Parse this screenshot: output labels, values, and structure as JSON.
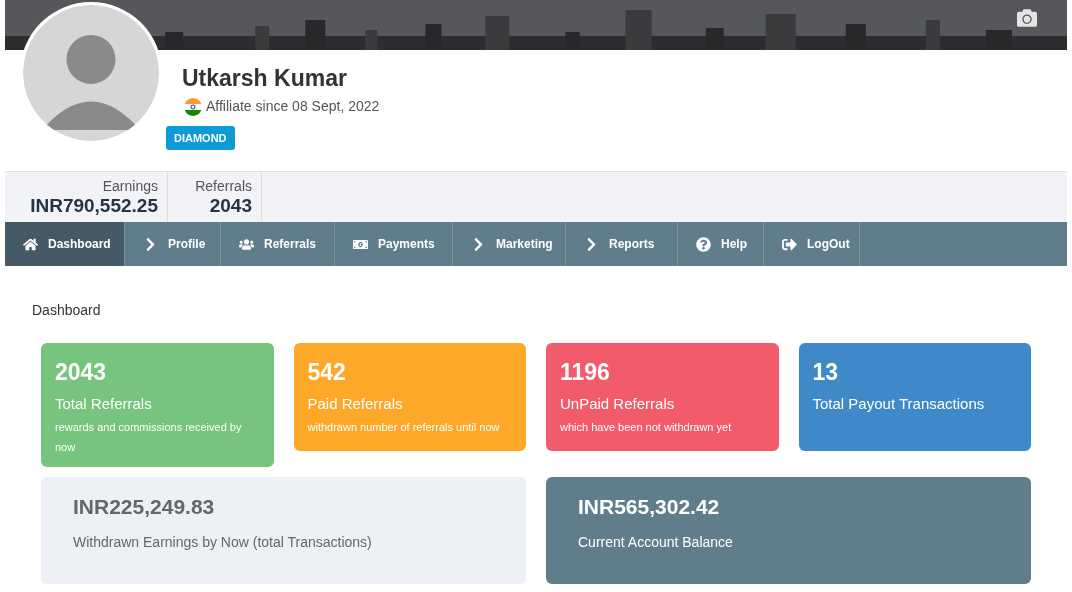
{
  "profile": {
    "name": "Utkarsh Kumar",
    "since": "Affiliate since 08 Sept, 2022",
    "badge": "DIAMOND"
  },
  "stats": [
    {
      "label": "Earnings",
      "value": "INR790,552.25"
    },
    {
      "label": "Referrals",
      "value": "2043"
    }
  ],
  "nav": [
    {
      "label": "Dashboard",
      "selected": true
    },
    {
      "label": "Profile",
      "selected": false
    },
    {
      "label": "Referrals",
      "selected": false
    },
    {
      "label": "Payments",
      "selected": false
    },
    {
      "label": "Marketing",
      "selected": false
    },
    {
      "label": "Reports",
      "selected": false
    },
    {
      "label": "Help",
      "selected": false
    },
    {
      "label": "LogOut",
      "selected": false
    }
  ],
  "section_title": "Dashboard",
  "cards": [
    {
      "value": "2043",
      "title": "Total Referrals",
      "note": "rewards and commissions received by now",
      "color": "#76c47d"
    },
    {
      "value": "542",
      "title": "Paid Referrals",
      "note": "withdrawn number of referrals until now",
      "color": "#fea82a"
    },
    {
      "value": "1196",
      "title": "UnPaid Referrals",
      "note": "which have been not withdrawn yet",
      "color": "#f15b6a"
    },
    {
      "value": "13",
      "title": "Total Payout Transactions",
      "color": "#3f89c9"
    }
  ],
  "summary": [
    {
      "kind": "light",
      "value": "INR225,249.83",
      "label": "Withdrawn Earnings by Now (total Transactions)"
    },
    {
      "kind": "dark",
      "value": "INR565,302.42",
      "label": "Current Account Balance"
    }
  ]
}
